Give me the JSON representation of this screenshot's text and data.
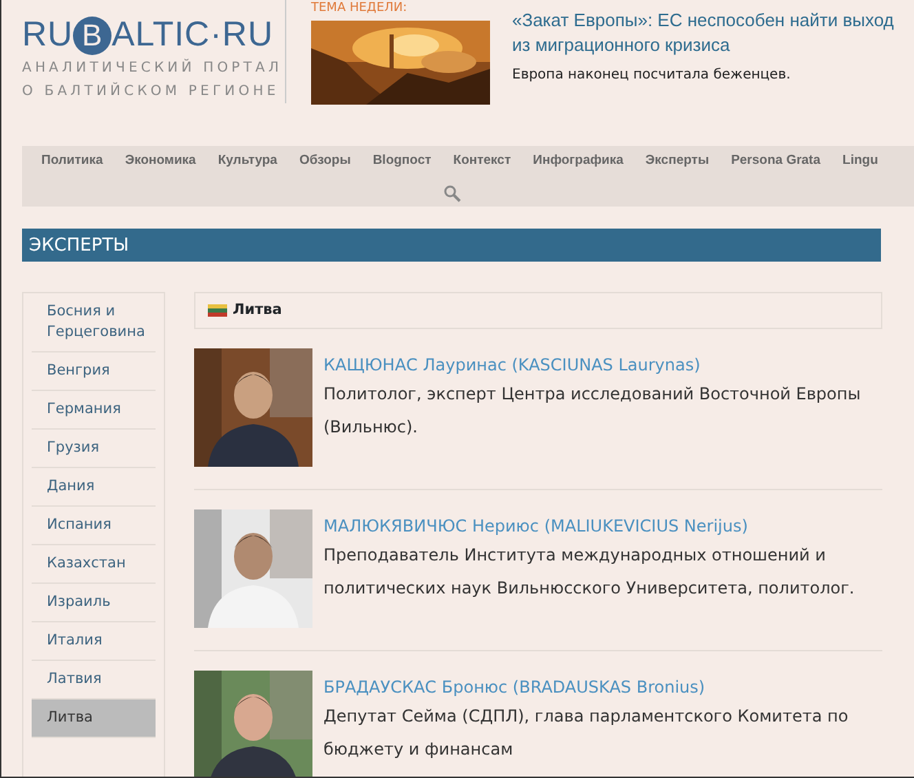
{
  "logo": {
    "before": "RU",
    "circled": "B",
    "after": "ALTIC·RU",
    "tagline": [
      "АНАЛИТИЧЕСКИЙ ПОРТАЛ",
      "О БАЛТИЙСКОМ РЕГИОНЕ"
    ]
  },
  "featured": {
    "label": "ТЕМА НЕДЕЛИ:",
    "headline": "«Закат Европы»: ЕС неспособен найти выход из миграционного кризиса",
    "summary": "Европа наконец посчитала беженцев."
  },
  "nav": [
    "Политика",
    "Экономика",
    "Культура",
    "Обзоры",
    "Blogпост",
    "Контекст",
    "Инфографика",
    "Эксперты",
    "Persona Grata",
    "Lingu"
  ],
  "section_title": "ЭКСПЕРТЫ",
  "sidebar": [
    {
      "label": "Босния и Герцеговина",
      "selected": false
    },
    {
      "label": "Венгрия",
      "selected": false
    },
    {
      "label": "Германия",
      "selected": false
    },
    {
      "label": "Грузия",
      "selected": false
    },
    {
      "label": "Дания",
      "selected": false
    },
    {
      "label": "Испания",
      "selected": false
    },
    {
      "label": "Казахстан",
      "selected": false
    },
    {
      "label": "Израиль",
      "selected": false
    },
    {
      "label": "Италия",
      "selected": false
    },
    {
      "label": "Латвия",
      "selected": false
    },
    {
      "label": "Литва",
      "selected": true
    }
  ],
  "country": "Литва",
  "experts": [
    {
      "name": "КАЩЮНАС Лауринас (KASCIUNAS Laurynas)",
      "description": "Политолог, эксперт Центра исследований Восточной Европы (Вильнюс)."
    },
    {
      "name": "МАЛЮКЯВИЧЮС Нериюс (MALIUKEVICIUS Nerijus)",
      "description": "Преподаватель Института международных отношений и политических наук Вильнюсского Университета, политолог."
    },
    {
      "name": "БРАДАУСКАС Бронюс (BRADAUSKAS Bronius)",
      "description": "Депутат Сейма (СДПЛ), глава парламентского Комитета по бюджету и финансам"
    }
  ]
}
